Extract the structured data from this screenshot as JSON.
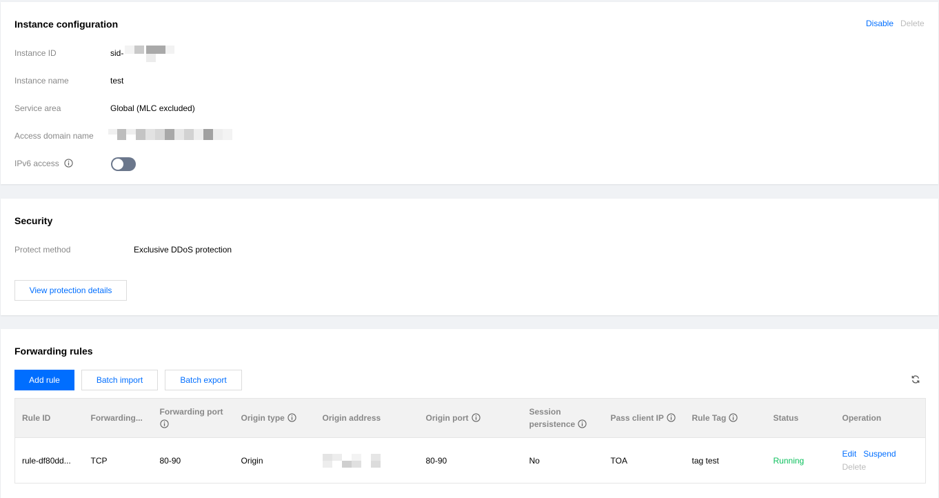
{
  "instance_config": {
    "title": "Instance configuration",
    "disable_label": "Disable",
    "delete_label": "Delete",
    "fields": {
      "instance_id": {
        "label": "Instance ID",
        "value": "sid-"
      },
      "instance_name": {
        "label": "Instance name",
        "value": "test"
      },
      "service_area": {
        "label": "Service area",
        "value": "Global (MLC excluded)"
      },
      "access_domain": {
        "label": "Access domain name"
      },
      "ipv6": {
        "label": "IPv6 access",
        "enabled": false
      }
    }
  },
  "security": {
    "title": "Security",
    "protect_label": "Protect method",
    "protect_value": "Exclusive DDoS protection",
    "view_details_label": "View protection details"
  },
  "forwarding": {
    "title": "Forwarding rules",
    "add_rule_label": "Add rule",
    "batch_import_label": "Batch import",
    "batch_export_label": "Batch export",
    "columns": {
      "rule_id": "Rule ID",
      "forwarding": "Forwarding...",
      "forwarding_port": "Forwarding port",
      "origin_type": "Origin type",
      "origin_address": "Origin address",
      "origin_port": "Origin port",
      "session_persistence": "Session persistence",
      "pass_client_ip": "Pass client IP",
      "rule_tag": "Rule Tag",
      "status": "Status",
      "operation": "Operation"
    },
    "rows": [
      {
        "rule_id": "rule-df80dd...",
        "protocol": "TCP",
        "forwarding_port": "80-90",
        "origin_type": "Origin",
        "origin_port": "80-90",
        "session_persistence": "No",
        "pass_client_ip": "TOA",
        "rule_tag": "tag test",
        "status": "Running",
        "edit_label": "Edit",
        "suspend_label": "Suspend",
        "delete_label": "Delete"
      }
    ]
  },
  "colors": {
    "accent": "#006eff",
    "status_running": "#0abf5b",
    "muted": "#888888"
  }
}
